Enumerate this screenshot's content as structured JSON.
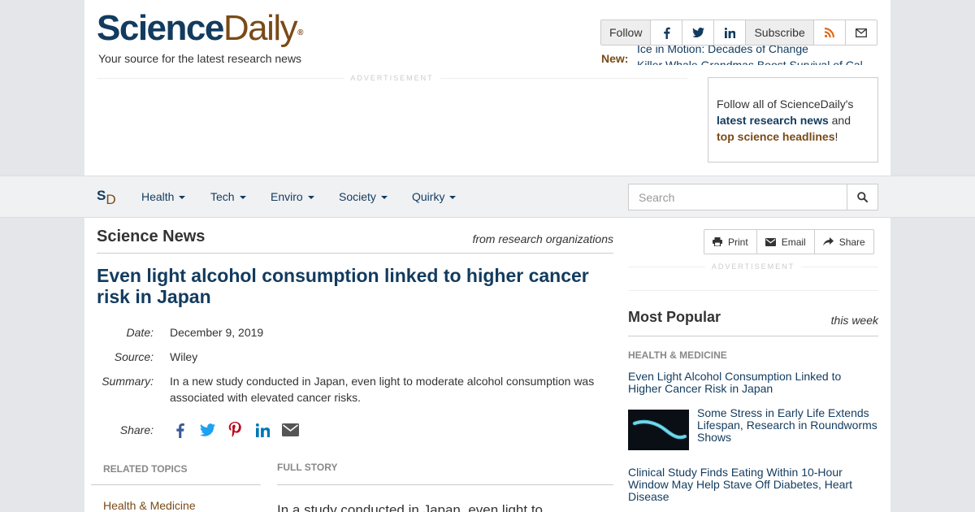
{
  "header": {
    "logo_science": "Science",
    "logo_daily": "Daily",
    "logo_reg": "®",
    "tagline": "Your source for the latest research news",
    "follow_label": "Follow",
    "subscribe_label": "Subscribe",
    "new_label": "New:",
    "ticker": [
      "Ice in Motion: Decades of Change",
      "Killer Whale Grandmas Boost Survival of Cal"
    ],
    "ad_label": "ADVERTISEMENT"
  },
  "follow_box": {
    "text1": "Follow all of ScienceDaily's",
    "link1": "latest research news",
    "text2": " and",
    "link2": "top science headlines",
    "text3": "!"
  },
  "nav": {
    "logo_s": "S",
    "logo_d": "D",
    "items": [
      "Health",
      "Tech",
      "Enviro",
      "Society",
      "Quirky"
    ],
    "search_placeholder": "Search"
  },
  "article": {
    "section_title": "Science News",
    "section_sub": "from research organizations",
    "headline": "Even light alcohol consumption linked to higher cancer risk in Japan",
    "labels": {
      "date": "Date:",
      "source": "Source:",
      "summary": "Summary:",
      "share": "Share:"
    },
    "date": "December 9, 2019",
    "source": "Wiley",
    "summary": "In a new study conducted in Japan, even light to moderate alcohol consumption was associated with elevated cancer risks.",
    "related_label": "RELATED TOPICS",
    "related_first": "Health & Medicine",
    "full_story_label": "FULL STORY",
    "story_start": "In a study conducted in Japan, even light to"
  },
  "tools": {
    "print": "Print",
    "email": "Email",
    "share": "Share"
  },
  "sidebar": {
    "ad_label": "ADVERTISEMENT",
    "most_popular": "Most Popular",
    "period": "this week",
    "category": "HEALTH & MEDICINE",
    "items": [
      "Even Light Alcohol Consumption Linked to Higher Cancer Risk in Japan",
      "Some Stress in Early Life Extends Lifespan, Research in Roundworms Shows",
      "Clinical Study Finds Eating Within 10-Hour Window May Help Stave Off Diabetes, Heart Disease"
    ]
  },
  "colors": {
    "brand_blue": "#123b5f",
    "brand_brown": "#7a4a17",
    "rss_orange": "#e06b1a"
  },
  "icons": [
    "facebook-icon",
    "twitter-icon",
    "linkedin-icon",
    "rss-icon",
    "envelope-icon",
    "search-icon",
    "print-icon",
    "share-icon",
    "pinterest-icon"
  ]
}
